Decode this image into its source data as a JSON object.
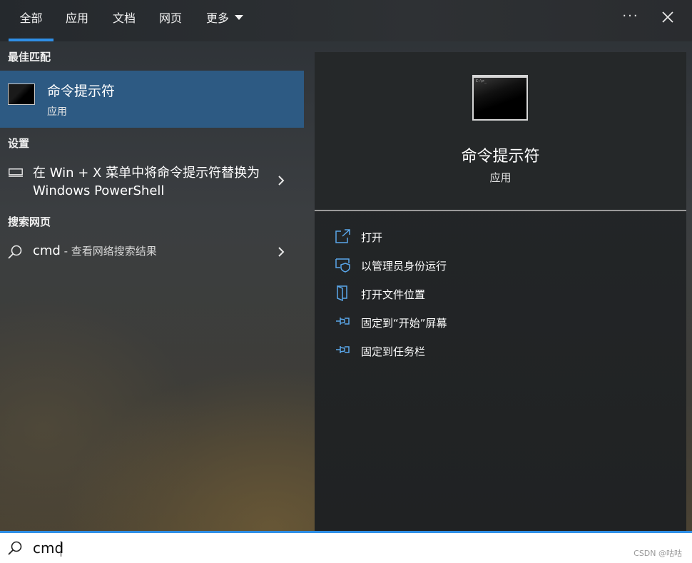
{
  "tabs": [
    {
      "label": "全部",
      "active": true
    },
    {
      "label": "应用",
      "active": false
    },
    {
      "label": "文档",
      "active": false
    },
    {
      "label": "网页",
      "active": false
    },
    {
      "label": "更多",
      "active": false
    }
  ],
  "header_icons": [
    "more-icon",
    "close-icon"
  ],
  "left": {
    "best_match_title": "最佳匹配",
    "best_match": {
      "name": "命令提示符",
      "type": "应用",
      "icon": "command-prompt-icon"
    },
    "settings_title": "设置",
    "setting_item": {
      "text": "在 Win + X 菜单中将命令提示符替换为 Windows PowerShell",
      "icon": "monitor-icon"
    },
    "web_title": "搜索网页",
    "web_item": {
      "query": "cmd",
      "hint": " - 查看网络搜索结果",
      "icon": "search-icon"
    }
  },
  "preview": {
    "name": "命令提示符",
    "type": "应用",
    "actions": [
      {
        "label": "打开",
        "icon": "open-icon"
      },
      {
        "label": "以管理员身份运行",
        "icon": "shield-icon"
      },
      {
        "label": "打开文件位置",
        "icon": "folder-icon"
      },
      {
        "label": "固定到“开始”屏幕",
        "icon": "pin-icon"
      },
      {
        "label": "固定到任务栏",
        "icon": "pin-icon"
      }
    ]
  },
  "search": {
    "value": "cmd"
  },
  "watermark": "CSDN @咕咕",
  "colors": {
    "accent": "#2f8fe6",
    "selected": "#2d5a83"
  }
}
